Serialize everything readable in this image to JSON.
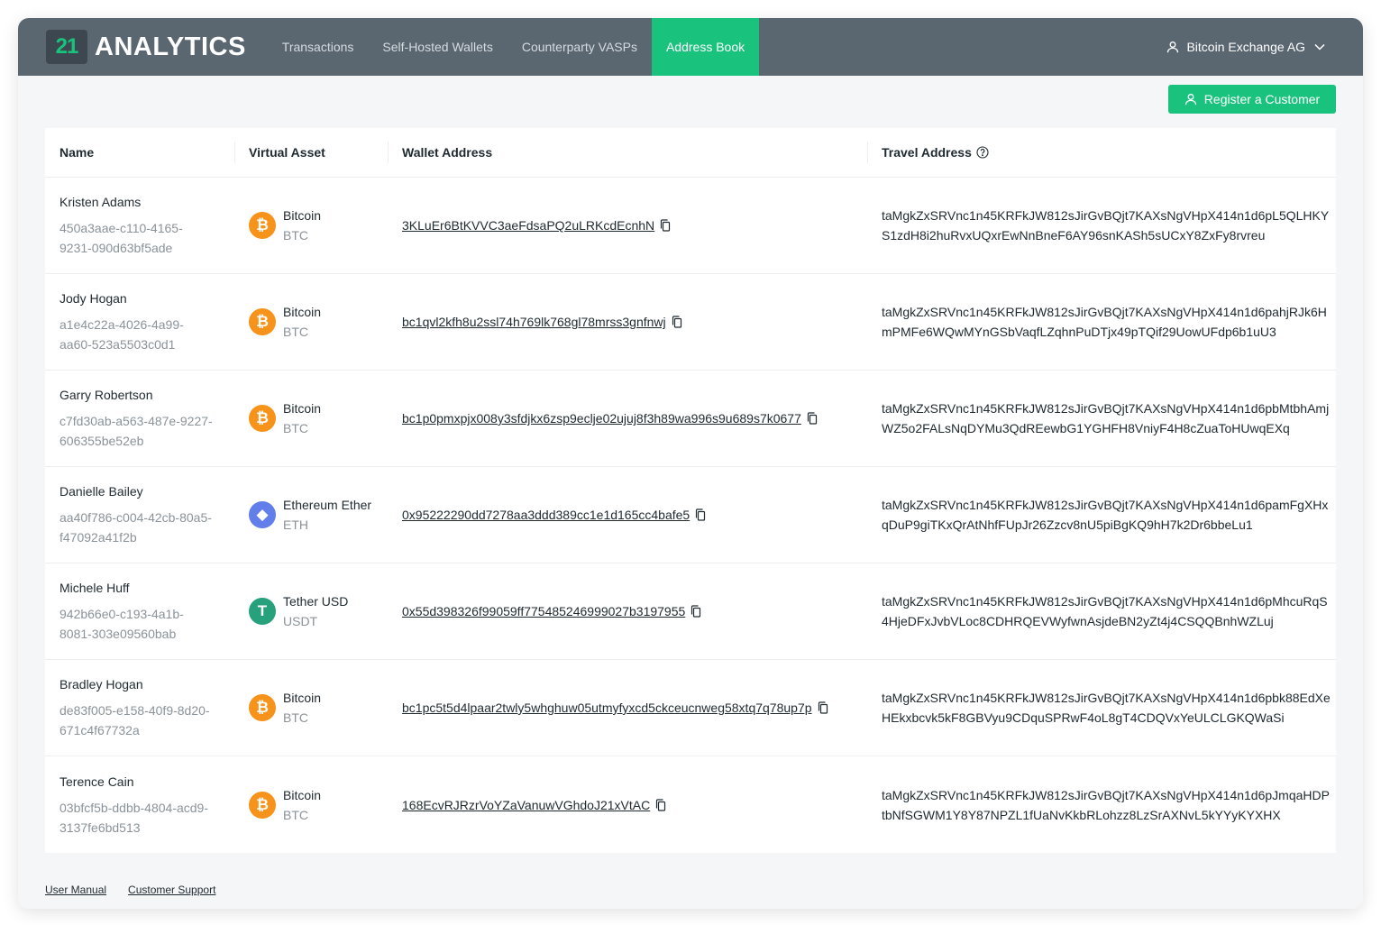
{
  "brand": {
    "logo_mark": "21",
    "logo_text": "ANALYTICS"
  },
  "nav": [
    {
      "label": "Transactions"
    },
    {
      "label": "Self-Hosted Wallets"
    },
    {
      "label": "Counterparty VASPs"
    },
    {
      "label": "Address Book"
    }
  ],
  "account": {
    "label": "Bitcoin Exchange AG",
    "icon": "user-icon"
  },
  "actions": {
    "register_label": "Register a Customer"
  },
  "table": {
    "headers": [
      "Name",
      "Virtual Asset",
      "Wallet Address",
      "Travel Address"
    ],
    "rows": [
      {
        "name": "Kristen Adams",
        "uuid": "450a3aae-c110-4165-9231-090d63bf5ade",
        "asset": "Bitcoin",
        "code": "BTC",
        "wallet": "3KLuEr6BtKVVC3aeFdsaPQ2uLRKcdEcnhN",
        "travel": "taMgkZxSRVnc1n45KRFkJW812sJirGvBQjt7KAXsNgVHpX414n1d6pL5QLHKYS1zdH8i2huRvxUQxrEwNnBneF6AY96snKASh5sUCxY8ZxFy8rvreu"
      },
      {
        "name": "Jody Hogan",
        "uuid": "a1e4c22a-4026-4a99-aa60-523a5503c0d1",
        "asset": "Bitcoin",
        "code": "BTC",
        "wallet": "bc1qvl2kfh8u2ssl74h769lk768gl78mrss3gnfnwj",
        "travel": "taMgkZxSRVnc1n45KRFkJW812sJirGvBQjt7KAXsNgVHpX414n1d6pahjRJk6HmPMFe6WQwMYnGSbVaqfLZqhnPuDTjx49pTQif29UowUFdp6b1uU3"
      },
      {
        "name": "Garry Robertson",
        "uuid": "c7fd30ab-a563-487e-9227-606355be52eb",
        "asset": "Bitcoin",
        "code": "BTC",
        "wallet": "bc1p0pmxpjx008y3sfdjkx6zsp9eclje02ujuj8f3h89wa996s9u689s7k0677",
        "travel": "taMgkZxSRVnc1n45KRFkJW812sJirGvBQjt7KAXsNgVHpX414n1d6pbMtbhAmjWZ5o2FALsNqDYMu3QdREewbG1YGHFH8VniyF4H8cZuaToHUwqEXq"
      },
      {
        "name": "Danielle Bailey",
        "uuid": "aa40f786-c004-42cb-80a5-f47092a41f2b",
        "asset": "Ethereum Ether",
        "code": "ETH",
        "wallet": "0x95222290dd7278aa3ddd389cc1e1d165cc4bafe5",
        "travel": "taMgkZxSRVnc1n45KRFkJW812sJirGvBQjt7KAXsNgVHpX414n1d6pamFgXHxqDuP9giTKxQrAtNhfFUpJr26Zzcv8nU5piBgKQ9hH7k2Dr6bbeLu1"
      },
      {
        "name": "Michele Huff",
        "uuid": "942b66e0-c193-4a1b-8081-303e09560bab",
        "asset": "Tether USD",
        "code": "USDT",
        "wallet": "0x55d398326f99059ff775485246999027b3197955",
        "travel": "taMgkZxSRVnc1n45KRFkJW812sJirGvBQjt7KAXsNgVHpX414n1d6pMhcuRqS4HjeDFxJvbVLoc8CDHRQEVWyfwnAsjdeBN2yZt4j4CSQQBnhWZLuj"
      },
      {
        "name": "Bradley Hogan",
        "uuid": "de83f005-e158-40f9-8d20-671c4f67732a",
        "asset": "Bitcoin",
        "code": "BTC",
        "wallet": "bc1pc5t5d4lpaar2twly5whghuw05utmyfyxcd5ckceucnweg58xtq7q78up7p",
        "travel": "taMgkZxSRVnc1n45KRFkJW812sJirGvBQjt7KAXsNgVHpX414n1d6pbk88EdXeHEkxbcvk5kF8GBVyu9CDquSPRwF4oL8gT4CDQVxYeULCLGKQWaSi"
      },
      {
        "name": "Terence Cain",
        "uuid": "03bfcf5b-ddbb-4804-acd9-3137fe6bd513",
        "asset": "Bitcoin",
        "code": "BTC",
        "wallet": "168EcvRJRzrVoYZaVanuwVGhdoJ21xVtAC",
        "travel": "taMgkZxSRVnc1n45KRFkJW812sJirGvBQjt7KAXsNgVHpX414n1d6pJmqaHDPtbNfSGWM1Y8Y87NPZL1fUaNvKkbRLohzz8LzSrAXNvL5kYYyKYXHX"
      }
    ]
  },
  "footer": {
    "manual": "User Manual",
    "support": "Customer Support"
  },
  "colors": {
    "accent": "#19c37d",
    "nav_bg": "#5a6670",
    "btc": "#f7931a",
    "eth": "#627eea",
    "usdt": "#26a17b"
  }
}
